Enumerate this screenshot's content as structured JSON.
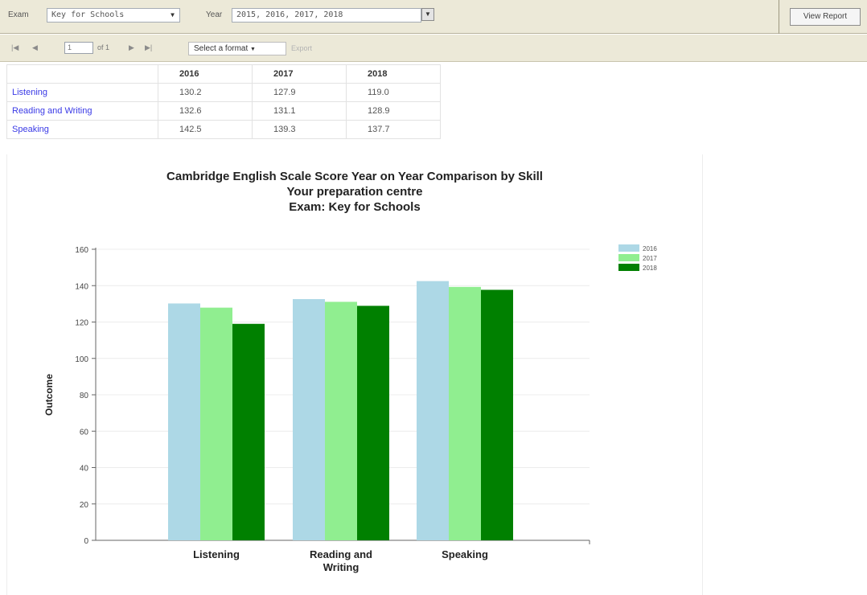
{
  "params": {
    "exam_label": "Exam",
    "exam_value": "Key for Schools",
    "year_label": "Year",
    "year_value": "2015, 2016, 2017, 2018",
    "view_report_label": "View Report"
  },
  "toolbar": {
    "first_icon": "first-page-icon",
    "prev_icon": "previous-page-icon",
    "page_value": "1",
    "page_of": "of 1",
    "next_icon": "next-page-icon",
    "last_icon": "last-page-icon",
    "format_placeholder": "Select a format",
    "export_label": "Export"
  },
  "table": {
    "headers": [
      "",
      "2016",
      "2017",
      "2018"
    ],
    "rows": [
      {
        "label": "Listening",
        "values": [
          "130.2",
          "127.9",
          "119.0"
        ]
      },
      {
        "label": "Reading and Writing",
        "values": [
          "132.6",
          "131.1",
          "128.9"
        ]
      },
      {
        "label": "Speaking",
        "values": [
          "142.5",
          "139.3",
          "137.7"
        ]
      }
    ]
  },
  "chart_data": {
    "type": "bar",
    "title_lines": [
      "Cambridge English Scale Score Year on Year Comparison by Skill",
      "Your preparation centre",
      "Exam: Key for Schools"
    ],
    "xlabel": "",
    "ylabel": "Outcome",
    "categories": [
      [
        "Listening"
      ],
      [
        "Reading and",
        "Writing"
      ],
      [
        "Speaking"
      ]
    ],
    "series": [
      {
        "name": "2016",
        "color": "#add8e6",
        "values": [
          130.2,
          132.6,
          142.5
        ]
      },
      {
        "name": "2017",
        "color": "#90ee90",
        "values": [
          127.9,
          131.1,
          139.3
        ]
      },
      {
        "name": "2018",
        "color": "#008000",
        "values": [
          119.0,
          128.9,
          137.7
        ]
      }
    ],
    "ylim": [
      0,
      160
    ],
    "yticks": [
      0,
      20,
      40,
      60,
      80,
      100,
      120,
      140,
      160
    ],
    "grid": true,
    "legend": "top-right"
  }
}
